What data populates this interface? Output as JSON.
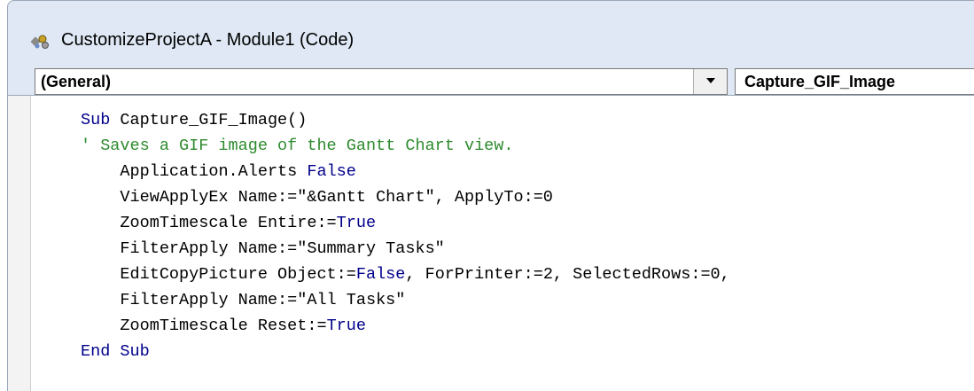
{
  "window": {
    "title": "CustomizeProjectA - Module1 (Code)",
    "icon": "vba-module-icon"
  },
  "object_combo": {
    "value": "(General)"
  },
  "procedure_combo": {
    "value": "Capture_GIF_Image"
  },
  "code": {
    "lines": [
      {
        "indent": "",
        "tokens": [
          {
            "t": "Sub",
            "c": "kw"
          },
          {
            "t": " Capture_GIF_Image()",
            "c": ""
          }
        ]
      },
      {
        "indent": "",
        "tokens": [
          {
            "t": "' Saves a GIF image of the Gantt Chart view.",
            "c": "cm"
          }
        ]
      },
      {
        "indent": "    ",
        "tokens": [
          {
            "t": "Application.Alerts ",
            "c": ""
          },
          {
            "t": "False",
            "c": "kw"
          }
        ]
      },
      {
        "indent": "    ",
        "tokens": [
          {
            "t": "ViewApplyEx Name:=\"&Gantt Chart\", ApplyTo:=0",
            "c": ""
          }
        ]
      },
      {
        "indent": "    ",
        "tokens": [
          {
            "t": "ZoomTimescale Entire:=",
            "c": ""
          },
          {
            "t": "True",
            "c": "kw"
          }
        ]
      },
      {
        "indent": "    ",
        "tokens": [
          {
            "t": "FilterApply Name:=\"Summary Tasks\"",
            "c": ""
          }
        ]
      },
      {
        "indent": "    ",
        "tokens": [
          {
            "t": "EditCopyPicture Object:=",
            "c": ""
          },
          {
            "t": "False",
            "c": "kw"
          },
          {
            "t": ", ForPrinter:=2, SelectedRows:=0,",
            "c": ""
          }
        ]
      },
      {
        "indent": "    ",
        "tokens": [
          {
            "t": "FilterApply Name:=\"All Tasks\"",
            "c": ""
          }
        ]
      },
      {
        "indent": "    ",
        "tokens": [
          {
            "t": "ZoomTimescale Reset:=",
            "c": ""
          },
          {
            "t": "True",
            "c": "kw"
          }
        ]
      },
      {
        "indent": "",
        "tokens": [
          {
            "t": "End Sub",
            "c": "kw"
          }
        ]
      }
    ]
  },
  "colors": {
    "keyword": "#00008b",
    "comment": "#2e8b2e",
    "chrome": "#dfe8f4"
  }
}
